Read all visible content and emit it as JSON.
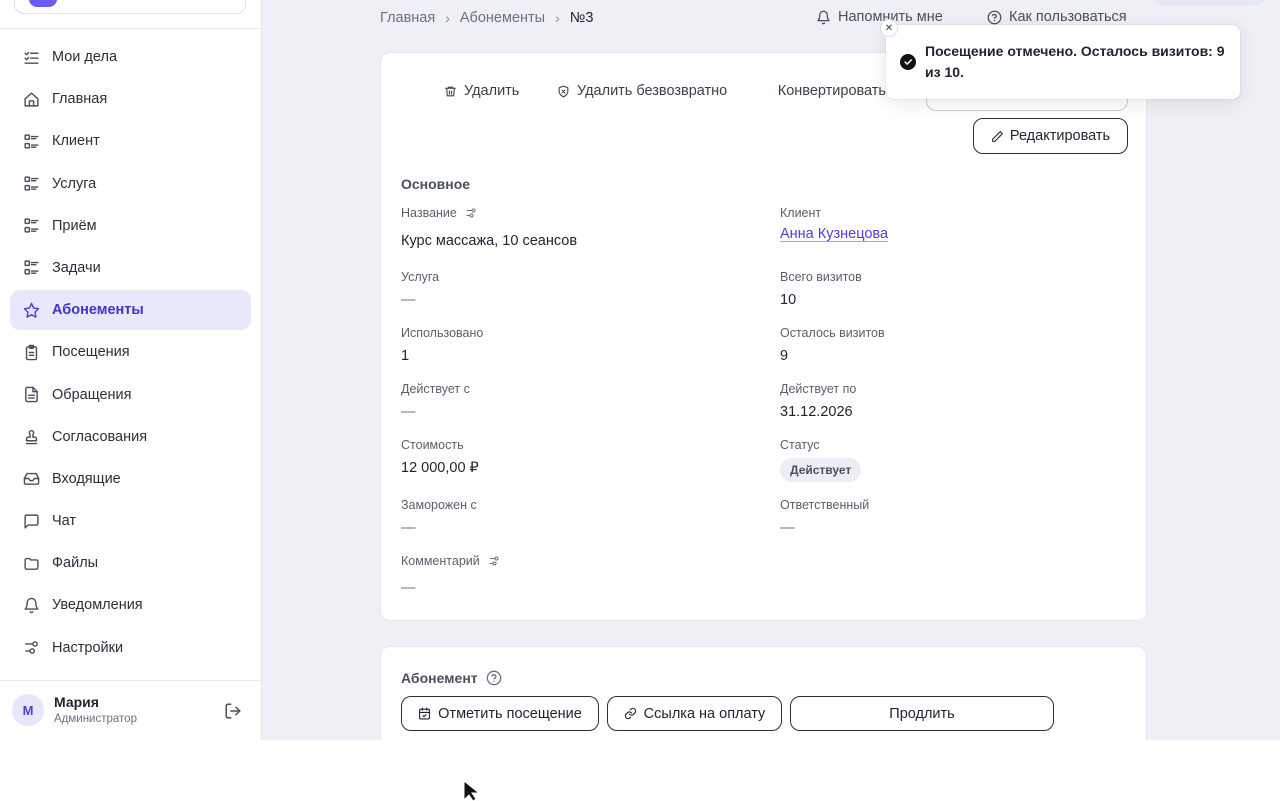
{
  "sidebar": {
    "items": [
      {
        "label": "Мои дела",
        "icon": "checklist-icon",
        "active": false
      },
      {
        "label": "Главная",
        "icon": "home-icon",
        "active": false
      },
      {
        "label": "Клиент",
        "icon": "list-icon",
        "active": false
      },
      {
        "label": "Услуга",
        "icon": "list-icon",
        "active": false
      },
      {
        "label": "Приём",
        "icon": "list-icon",
        "active": false
      },
      {
        "label": "Задачи",
        "icon": "list-icon",
        "active": false
      },
      {
        "label": "Абонементы",
        "icon": "star-icon",
        "active": true
      },
      {
        "label": "Посещения",
        "icon": "clipboard-icon",
        "active": false
      },
      {
        "label": "Обращения",
        "icon": "document-icon",
        "active": false
      },
      {
        "label": "Согласования",
        "icon": "stamp-icon",
        "active": false
      },
      {
        "label": "Входящие",
        "icon": "inbox-icon",
        "active": false
      },
      {
        "label": "Чат",
        "icon": "chat-icon",
        "active": false
      },
      {
        "label": "Файлы",
        "icon": "folder-icon",
        "active": false
      },
      {
        "label": "Уведомления",
        "icon": "bell-icon",
        "active": false
      },
      {
        "label": "Настройки",
        "icon": "sliders-icon",
        "active": false
      }
    ],
    "user": {
      "initial": "М",
      "name": "Мария",
      "role": "Администратор"
    }
  },
  "header": {
    "breadcrumb": [
      "Главная",
      "Абонементы",
      "№3"
    ],
    "remind_label": "Напомнить мне",
    "help_label": "Как пользоваться"
  },
  "toolbar": {
    "delete_label": "Удалить",
    "delete_forever_label": "Удалить безвозвратно",
    "convert_label": "Конвертировать",
    "edit_label": "Редактировать"
  },
  "details": {
    "section_title": "Основное",
    "name_label": "Название",
    "name_value": "Курс массажа, 10 сеансов",
    "client_label": "Клиент",
    "client_value": "Анна Кузнецова",
    "service_label": "Услуга",
    "service_value": "—",
    "total_label": "Всего визитов",
    "total_value": "10",
    "used_label": "Использовано",
    "used_value": "1",
    "left_label": "Осталось визитов",
    "left_value": "9",
    "from_label": "Действует с",
    "from_value": "—",
    "to_label": "Действует по",
    "to_value": "31.12.2026",
    "price_label": "Стоимость",
    "price_value": "12 000,00 ₽",
    "status_label": "Статус",
    "status_value": "Действует",
    "frozen_label": "Заморожен с",
    "frozen_value": "—",
    "owner_label": "Ответственный",
    "owner_value": "—",
    "comment_label": "Комментарий",
    "comment_value": "—"
  },
  "subscription": {
    "title": "Абонемент",
    "mark_visit_label": "Отметить посещение",
    "payment_link_label": "Ссылка на оплату",
    "extend_label": "Продлить"
  },
  "toast": {
    "message": "Посещение отмечено. Осталось визитов: 9 из 10."
  }
}
